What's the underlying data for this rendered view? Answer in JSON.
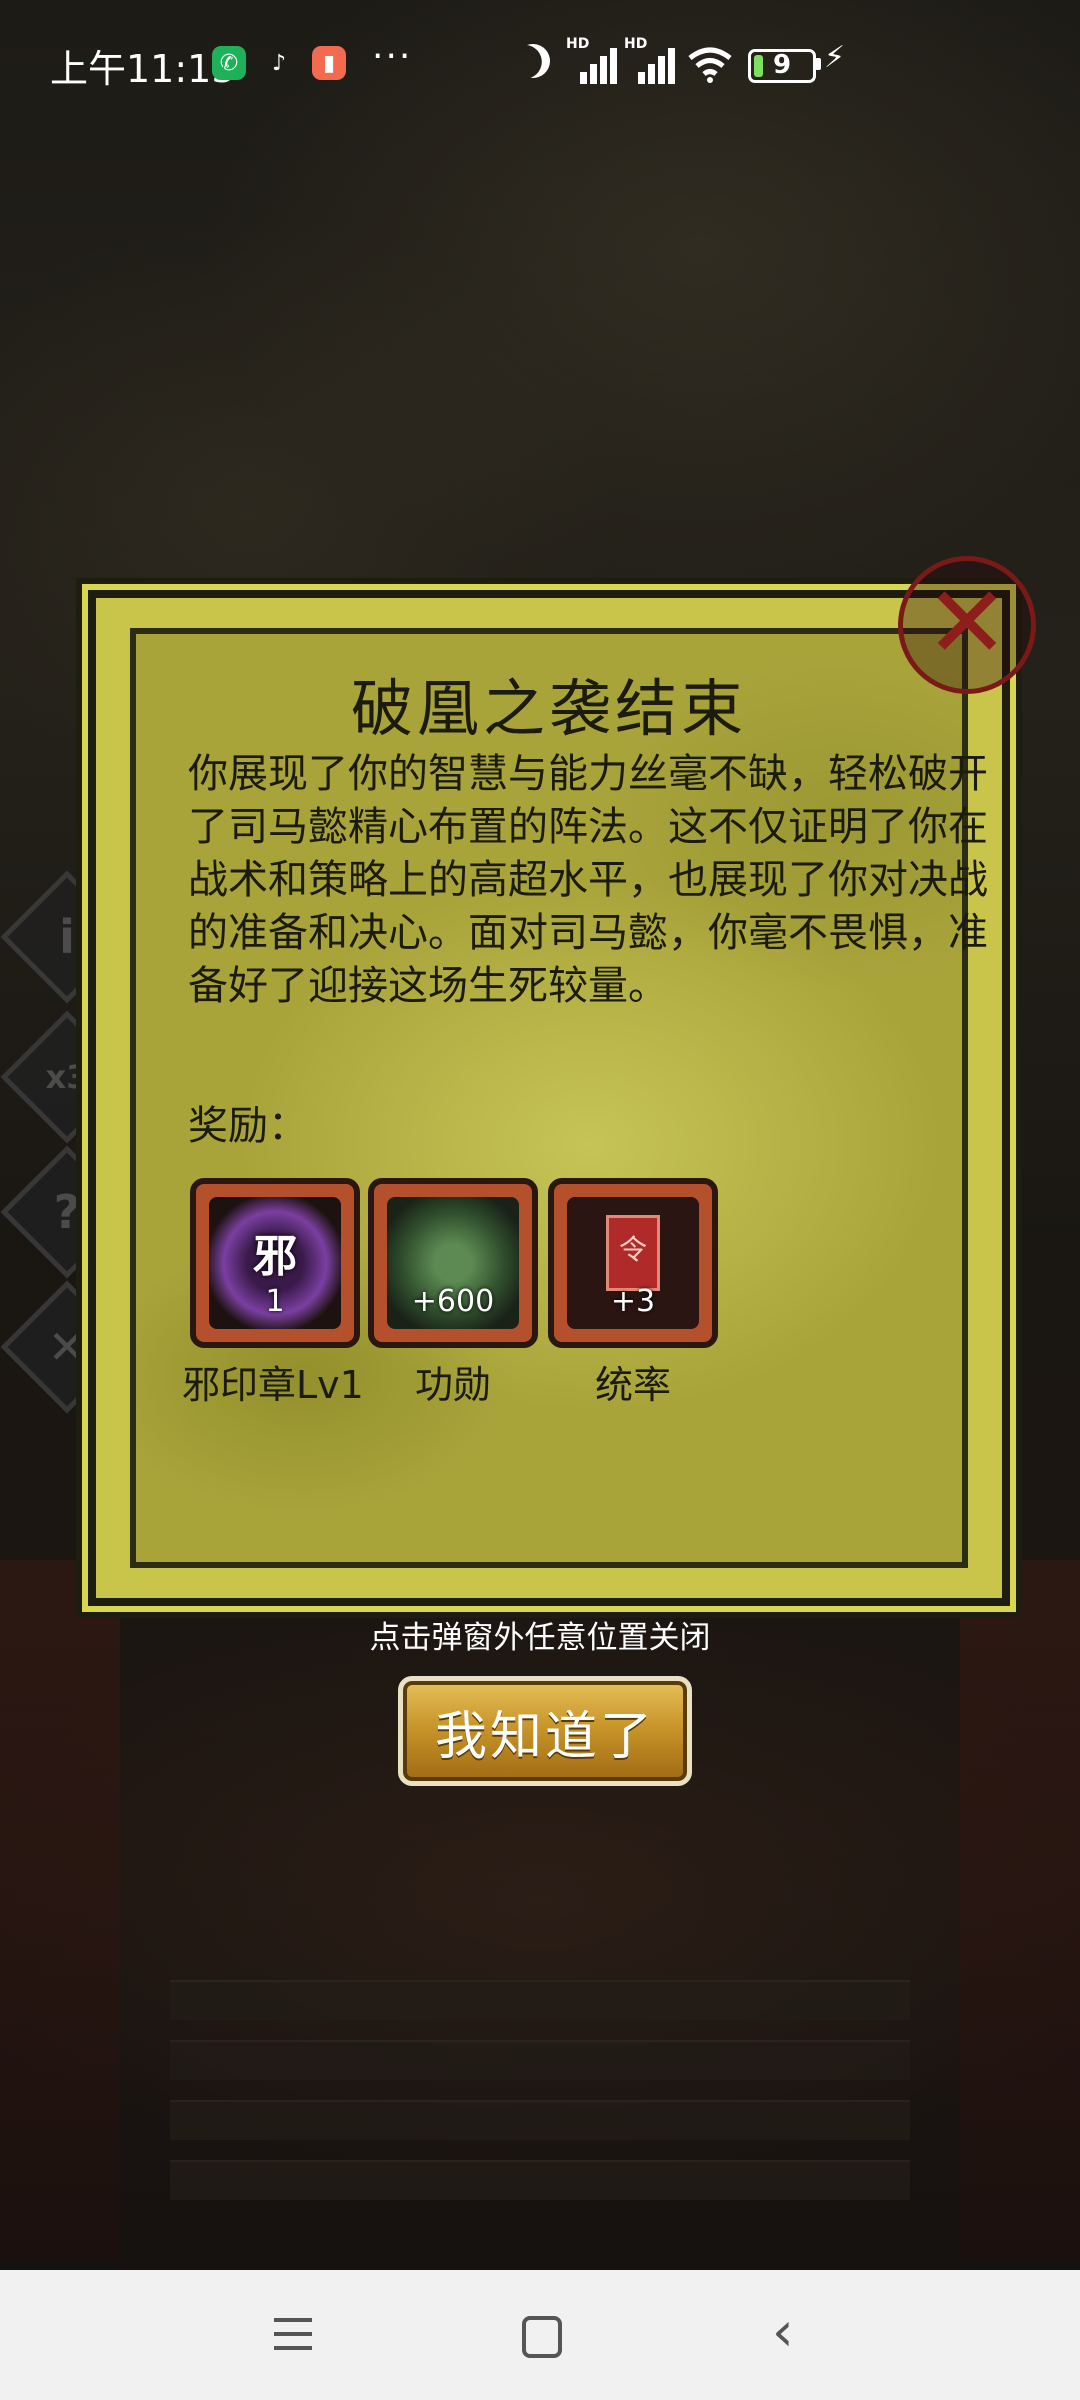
{
  "status_bar": {
    "time": "上午11:13",
    "battery_level": "9",
    "icons": [
      "phone-app-icon",
      "tiktok-icon",
      "clipboard-app-icon",
      "more-dots-icon",
      "do-not-disturb-moon-icon",
      "hd-signal-icon",
      "hd-signal-icon",
      "wifi-icon",
      "battery-icon",
      "charging-bolt-icon"
    ],
    "more": "···",
    "hd": "HD"
  },
  "side_buttons": {
    "info": "i",
    "speed": "x3",
    "help": "?",
    "close": "✕"
  },
  "dialog": {
    "title": "破凰之袭结束",
    "body": "你展现了你的智慧与能力丝毫不缺，轻松破开了司马懿精心布置的阵法。这不仅证明了你在战术和策略上的高超水平，也展现了你对决战的准备和决心。面对司马懿，你毫不畏惧，准备好了迎接这场生死较量。",
    "rewards_label": "奖励：",
    "rewards": [
      {
        "name": "邪印章Lv1",
        "glyph": "邪",
        "quantity": "1",
        "icon": "evil-seal-icon",
        "color": "#7a3fa0"
      },
      {
        "name": "功勋",
        "glyph": "",
        "quantity": "+600",
        "icon": "merit-medal-icon",
        "color": "#3d6a3a"
      },
      {
        "name": "统率",
        "glyph": "令",
        "quantity": "+3",
        "icon": "command-token-icon",
        "color": "#b02a2a"
      }
    ],
    "close_icon": "✕"
  },
  "hint": "点击弹窗外任意位置关闭",
  "ok_button": "我知道了",
  "colors": {
    "dialog_bg": "#c9c54a",
    "button_gold": "#c8962a",
    "close_red": "#8e1e1c"
  }
}
